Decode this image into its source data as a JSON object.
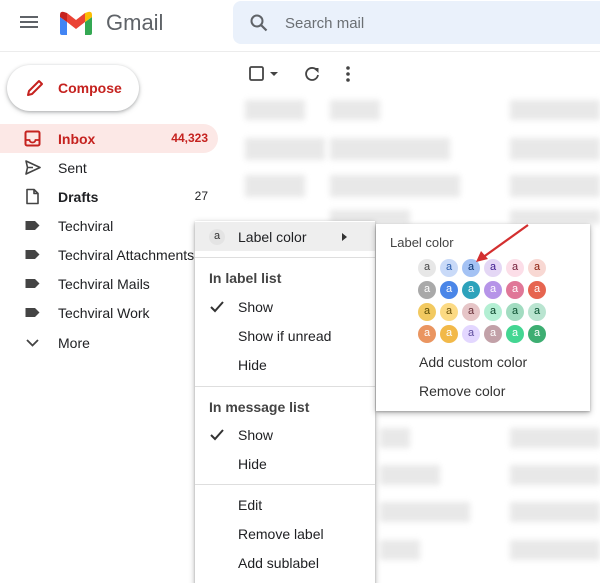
{
  "header": {
    "brand": "Gmail",
    "search_placeholder": "Search mail"
  },
  "sidebar": {
    "compose_label": "Compose",
    "items": [
      {
        "label": "Inbox",
        "count": "44,323"
      },
      {
        "label": "Sent",
        "count": ""
      },
      {
        "label": "Drafts",
        "count": "27"
      },
      {
        "label": "Techviral",
        "count": ""
      },
      {
        "label": "Techviral Attachments",
        "count": ""
      },
      {
        "label": "Techviral Mails",
        "count": ""
      },
      {
        "label": "Techviral Work",
        "count": ""
      },
      {
        "label": "More",
        "count": ""
      }
    ]
  },
  "context_menu": {
    "label_color": "Label color",
    "swatch_letter": "a",
    "in_label_list": "In label list",
    "label_list_show": "Show",
    "label_list_show_unread": "Show if unread",
    "label_list_hide": "Hide",
    "in_message_list": "In message list",
    "message_list_show": "Show",
    "message_list_hide": "Hide",
    "edit": "Edit",
    "remove_label": "Remove label",
    "add_sublabel": "Add sublabel"
  },
  "color_menu": {
    "title": "Label color",
    "letter": "a",
    "swatches": [
      [
        "#e7e7e7",
        "#c9daf8",
        "#a4c2f4",
        "#e4d7f5",
        "#fcdee8",
        "#f8d8d3"
      ],
      [
        "#a9a9a9",
        "#4a86e8",
        "#2da2bb",
        "#b694e8",
        "#e07798",
        "#e66550"
      ],
      [
        "#f2c960",
        "#fcda83",
        "#e6c5c7",
        "#b3efd3",
        "#a2dcc1",
        "#b9e4d0"
      ],
      [
        "#ea9560",
        "#f2b949",
        "#e3d7ff",
        "#c2a1a8",
        "#43d692",
        "#3dae72"
      ]
    ],
    "swatch_text_colors": [
      [
        "#464646",
        "#285bac",
        "#0d3472",
        "#3d188e",
        "#711a36",
        "#8a1c0a"
      ],
      [
        "#ffffff",
        "#ffffff",
        "#ffffff",
        "#ffffff",
        "#ffffff",
        "#ffffff"
      ],
      [
        "#594c05",
        "#684e07",
        "#662e37",
        "#094228",
        "#0b4f30",
        "#04502e"
      ],
      [
        "#ffffff",
        "#ffffff",
        "#5f4d9e",
        "#ffffff",
        "#ffffff",
        "#ffffff"
      ]
    ],
    "add_custom": "Add custom color",
    "remove": "Remove color"
  },
  "colors": {
    "accent_red": "#c5221f",
    "inbox_bg": "#fce8e6",
    "annotation_arrow": "#d32f2f"
  }
}
